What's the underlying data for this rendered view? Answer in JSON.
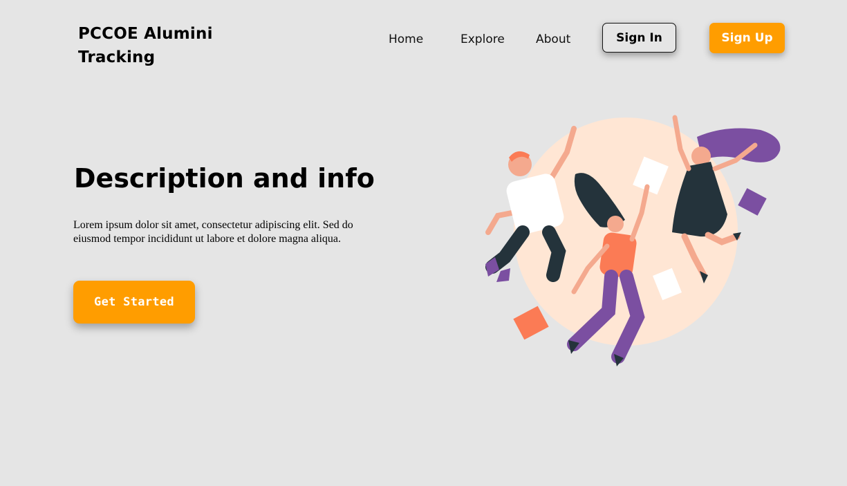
{
  "brand": {
    "title": "PCCOE Alumini Tracking"
  },
  "nav": {
    "home": "Home",
    "explore": "Explore",
    "about": "About",
    "sign_in": "Sign In",
    "sign_up": "Sign Up"
  },
  "hero": {
    "title": "Description and info",
    "description": "Lorem ipsum dolor sit amet, consectetur adipiscing elit. Sed do eiusmod tempor incididunt ut labore et dolore magna aliqua.",
    "cta": "Get Started"
  },
  "illustration": {
    "icon": "jumping-people-illustration"
  },
  "colors": {
    "background": "#e5e5e5",
    "accent": "#ff9d00",
    "circle": "#ffe6d4",
    "dark": "#24333b",
    "purple": "#7b4fa1",
    "coral": "#fb7b55"
  }
}
